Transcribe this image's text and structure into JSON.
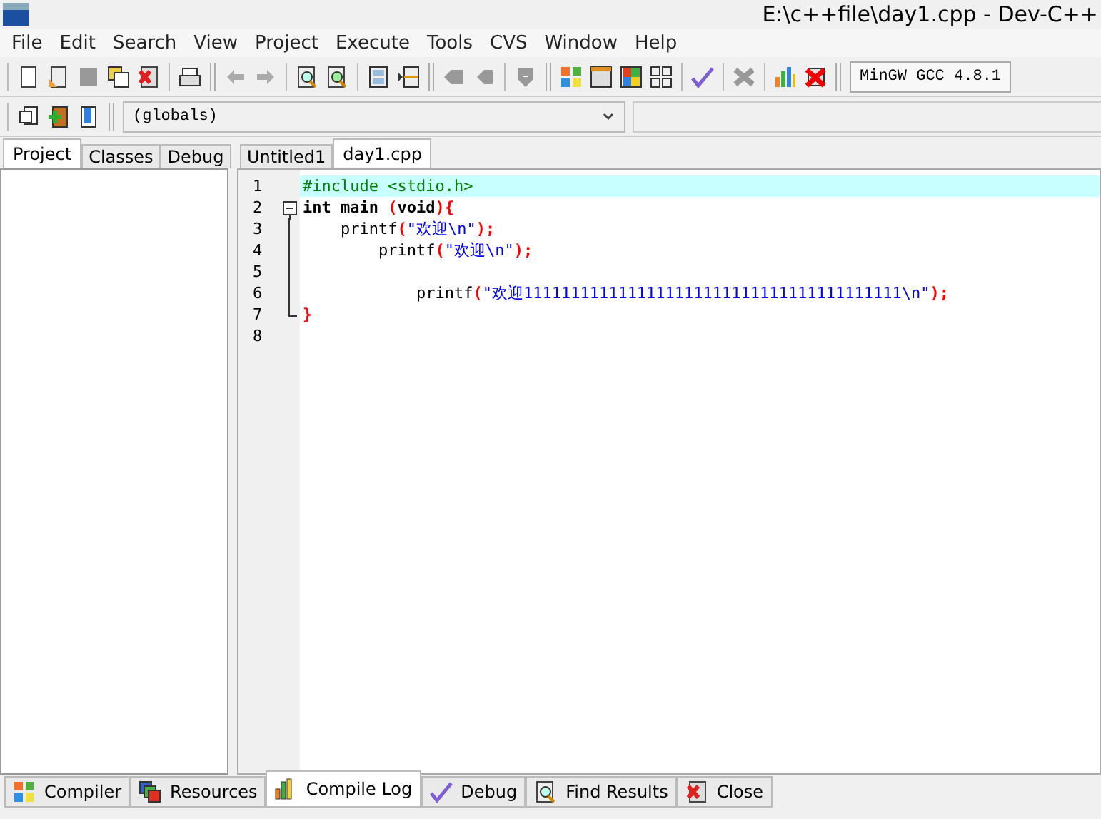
{
  "window": {
    "title": "E:\\c++file\\day1.cpp - Dev-C++"
  },
  "menu": [
    "File",
    "Edit",
    "Search",
    "View",
    "Project",
    "Execute",
    "Tools",
    "CVS",
    "Window",
    "Help"
  ],
  "compiler_select": {
    "value": "MinGW GCC 4.8.1"
  },
  "scope_select": {
    "value": "(globals)"
  },
  "side_tabs": [
    {
      "label": "Project",
      "selected": true
    },
    {
      "label": "Classes",
      "selected": false
    },
    {
      "label": "Debug",
      "selected": false
    }
  ],
  "editor_tabs": [
    {
      "label": "Untitled1",
      "selected": false
    },
    {
      "label": "day1.cpp",
      "selected": true
    }
  ],
  "code_lines": [
    {
      "number": "1",
      "kind": "plain",
      "highlighted": true,
      "tokens": [
        {
          "kind": "preproc",
          "text": "#include <stdio.h>"
        }
      ]
    },
    {
      "number": "2",
      "kind": "fold_start",
      "highlighted": false,
      "tokens": [
        {
          "kind": "keyword",
          "text": "int main "
        },
        {
          "kind": "symbol",
          "text": "("
        },
        {
          "kind": "keyword",
          "text": "void"
        },
        {
          "kind": "symbol",
          "text": "){"
        }
      ]
    },
    {
      "number": "3",
      "kind": "fold_body",
      "highlighted": false,
      "tokens": [
        {
          "kind": "plain",
          "text": "    printf"
        },
        {
          "kind": "symbol",
          "text": "("
        },
        {
          "kind": "string",
          "text": "\"欢迎\\n\""
        },
        {
          "kind": "symbol",
          "text": ");"
        }
      ]
    },
    {
      "number": "4",
      "kind": "fold_body",
      "highlighted": false,
      "tokens": [
        {
          "kind": "plain",
          "text": "        printf"
        },
        {
          "kind": "symbol",
          "text": "("
        },
        {
          "kind": "string",
          "text": "\"欢迎\\n\""
        },
        {
          "kind": "symbol",
          "text": ");"
        }
      ]
    },
    {
      "number": "5",
      "kind": "fold_body",
      "highlighted": false
    },
    {
      "number": "6",
      "kind": "fold_body",
      "highlighted": false,
      "tokens": [
        {
          "kind": "plain",
          "text": "            printf"
        },
        {
          "kind": "symbol",
          "text": "("
        },
        {
          "kind": "string",
          "text": "\"欢迎1111111111111111111111111111111111111111\\n\""
        },
        {
          "kind": "symbol",
          "text": ");"
        }
      ]
    },
    {
      "number": "7",
      "kind": "fold_end",
      "highlighted": false,
      "tokens": [
        {
          "kind": "symbol",
          "text": "}"
        }
      ]
    },
    {
      "number": "8",
      "kind": "plain",
      "highlighted": false
    }
  ],
  "bottom_tabs": [
    {
      "label": "Compiler",
      "selected": false
    },
    {
      "label": "Resources",
      "selected": false
    },
    {
      "label": "Compile Log",
      "selected": true
    },
    {
      "label": "Debug",
      "selected": false
    },
    {
      "label": "Find Results",
      "selected": false
    },
    {
      "label": "Close",
      "selected": false
    }
  ]
}
